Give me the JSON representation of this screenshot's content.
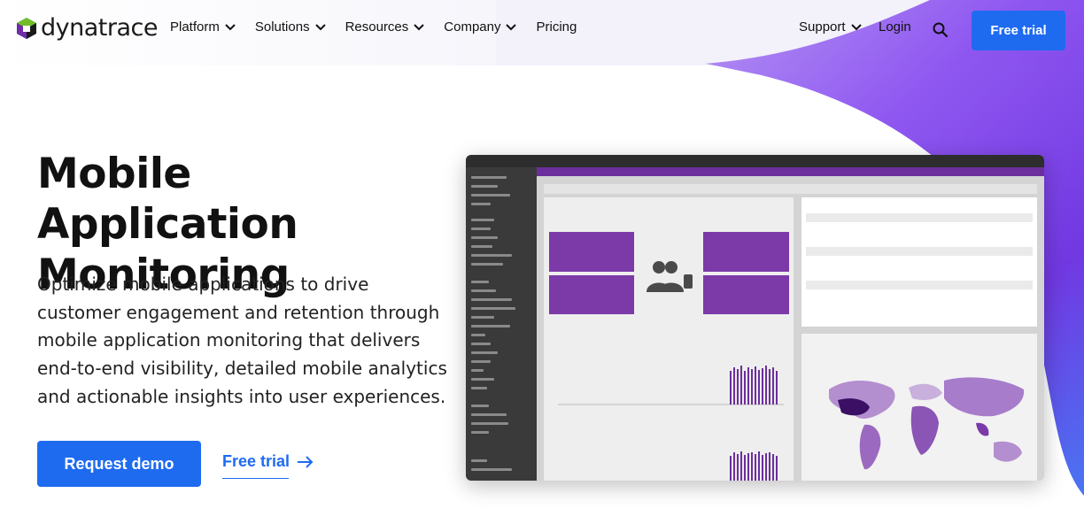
{
  "brand": {
    "name": "dynatrace"
  },
  "nav": {
    "items": [
      {
        "label": "Platform",
        "has_dropdown": true
      },
      {
        "label": "Solutions",
        "has_dropdown": true
      },
      {
        "label": "Resources",
        "has_dropdown": true
      },
      {
        "label": "Company",
        "has_dropdown": true
      },
      {
        "label": "Pricing",
        "has_dropdown": false
      }
    ],
    "support_label": "Support",
    "login_label": "Login",
    "free_trial_label": "Free trial",
    "search_icon": "search-icon"
  },
  "hero": {
    "title": "Mobile Application Monitoring",
    "description": "Optimize mobile applications to drive customer engagement and retention through mobile application monitoring that delivers end-to-end visibility, detailed mobile analytics and actionable insights into user experiences.",
    "primary_button": "Request demo",
    "secondary_link": "Free trial"
  },
  "colors": {
    "accent": "#1e6bf0",
    "purple": "#7b3aa8"
  }
}
